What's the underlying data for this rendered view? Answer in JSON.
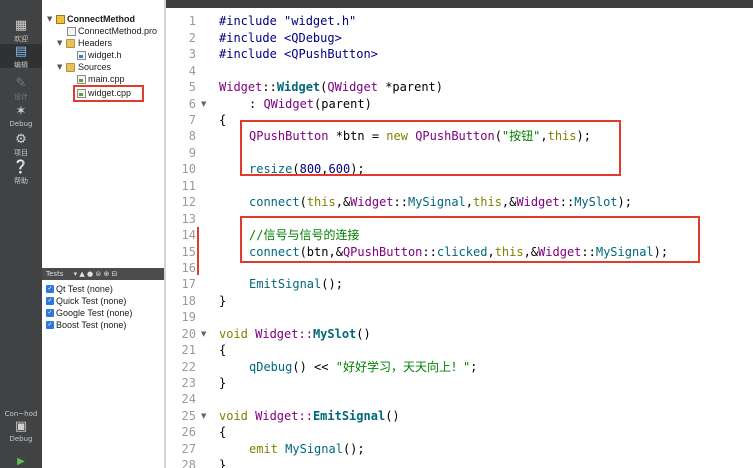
{
  "modes": [
    {
      "name": "welcome",
      "label": "欢迎",
      "icon": "grid-icon"
    },
    {
      "name": "edit",
      "label": "编辑",
      "icon": "edit-icon",
      "active": true
    },
    {
      "name": "design",
      "label": "设计",
      "icon": "pencil-icon",
      "disabled": true
    },
    {
      "name": "debug",
      "label": "Debug",
      "icon": "bug-icon"
    },
    {
      "name": "project",
      "label": "项目",
      "icon": "wrench-icon"
    },
    {
      "name": "help",
      "label": "帮助",
      "icon": "help-icon"
    }
  ],
  "kit": {
    "project_label": "Con~hod",
    "build_label": "Debug"
  },
  "tree": {
    "project": "ConnectMethod",
    "pro_file": "ConnectMethod.pro",
    "headers": "Headers",
    "header_file": "widget.h",
    "sources": "Sources",
    "source_main": "main.cpp",
    "source_widget": "widget.cpp"
  },
  "tests": {
    "title": "Tests",
    "items": [
      "Qt Test (none)",
      "Quick Test (none)",
      "Google Test (none)",
      "Boost Test (none)"
    ]
  },
  "colors": {
    "highlight": "#e23b2e",
    "sidebar": "#404244",
    "keyword": "#808000",
    "string": "#008000"
  },
  "code": {
    "include1": "#include \"widget.h\"",
    "include2": "#include <QDebug>",
    "include3": "#include <QPushButton>",
    "l5_class": "Widget",
    "l5_sep": "::",
    "l5_fn": "Widget",
    "l5_open": "(",
    "l5_type": "QWidget",
    "l5_rest": " *parent)",
    "l6_colon": ": ",
    "l6_base": "QWidget",
    "l6_rest": "(parent)",
    "brace_open": "{",
    "brace_close": "}",
    "l8_type": "QPushButton",
    "l8_mid": " *btn = ",
    "l8_new": "new",
    "l8_sp": " ",
    "l8_type2": "QPushButton",
    "l8_open": "(",
    "l8_str": "\"按钮\"",
    "l8_comma": ",",
    "l8_this": "this",
    "l8_close": ");",
    "l10_fn": "resize",
    "l10_open": "(",
    "l10_n1": "800",
    "l10_comma": ",",
    "l10_n2": "600",
    "l10_close": ");",
    "l12_fn": "connect",
    "l12_a": "(",
    "l12_this1": "this",
    "l12_b": ",&",
    "l12_c1": "Widget",
    "l12_d": "::",
    "l12_m1": "MySignal",
    "l12_e": ",",
    "l12_this2": "this",
    "l12_f": ",&",
    "l12_c2": "Widget",
    "l12_g": "::",
    "l12_m2": "MySlot",
    "l12_h": ");",
    "l14_comment": "//信号与信号的连接",
    "l15_fn": "connect",
    "l15_a": "(btn,&",
    "l15_c1": "QPushButton",
    "l15_b": "::",
    "l15_m1": "clicked",
    "l15_c": ",",
    "l15_this": "this",
    "l15_d": ",&",
    "l15_c2": "Widget",
    "l15_e": "::",
    "l15_m2": "MySignal",
    "l15_f": ");",
    "l17_fn": "EmitSignal",
    "l17_rest": "();",
    "l20_kw": "void",
    "l20_sp": " Widget::",
    "l20_fn": "MySlot",
    "l20_rest": "()",
    "l22_fn": "qDebug",
    "l22_mid": "() << ",
    "l22_str": "\"好好学习，天天向上！\"",
    "l22_end": ";",
    "l25_kw": "void",
    "l25_sp": " Widget::",
    "l25_fn": "EmitSignal",
    "l25_rest": "()",
    "l27_kw": "emit",
    "l27_sp": " ",
    "l27_fn": "MySignal",
    "l27_rest": "();"
  }
}
